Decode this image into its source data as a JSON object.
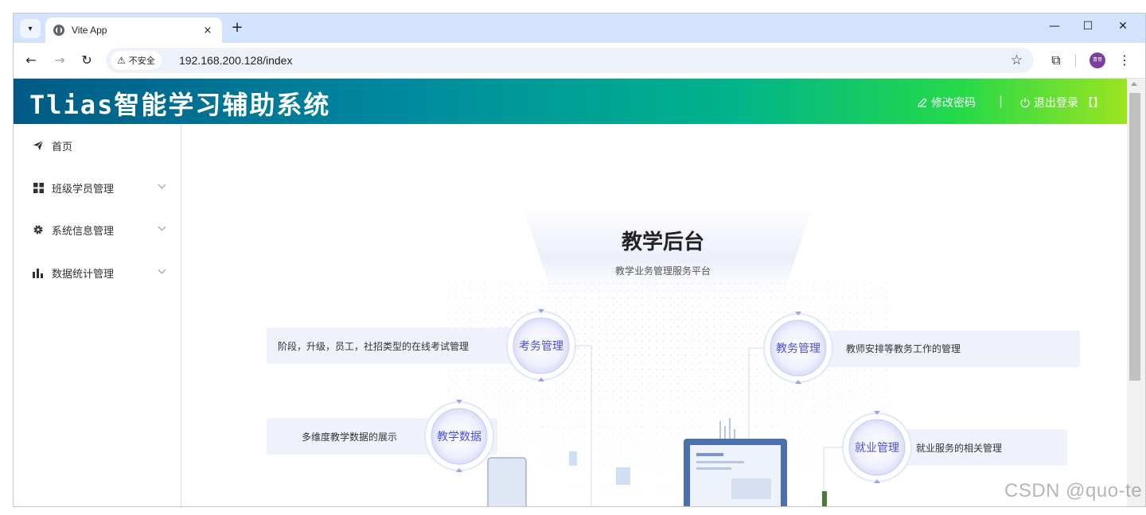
{
  "browser": {
    "tab_title": "Vite App",
    "tab_close": "×",
    "new_tab": "+",
    "security_label": "不安全",
    "url": "192.168.200.128/index",
    "avatar_text": "青哥"
  },
  "app": {
    "title": "Tlias智能学习辅助系统",
    "change_password": "修改密码",
    "separator": "|",
    "logout": "退出登录 【】"
  },
  "sidebar": {
    "items": [
      {
        "label": "首页",
        "icon": "paper-plane-icon",
        "expandable": false
      },
      {
        "label": "班级学员管理",
        "icon": "grid-icon",
        "expandable": true
      },
      {
        "label": "系统信息管理",
        "icon": "gear-icon",
        "expandable": true
      },
      {
        "label": "数据统计管理",
        "icon": "bar-chart-icon",
        "expandable": true
      }
    ]
  },
  "hero": {
    "title": "教学后台",
    "subtitle": "教学业务管理服务平台",
    "features": [
      {
        "name": "考务管理",
        "desc": "阶段，升级，员工，社招类型的在线考试管理"
      },
      {
        "name": "教务管理",
        "desc": "教师安排等教务工作的管理"
      },
      {
        "name": "教学数据",
        "desc": "多维度教学数据的展示"
      },
      {
        "name": "就业管理",
        "desc": "就业服务的相关管理"
      }
    ]
  },
  "watermark": "CSDN @quo-te",
  "colors": {
    "header_start": "#005a85",
    "header_end": "#9be41f",
    "feature_text": "#4a4fd8",
    "tab_strip": "#d3e3fd"
  }
}
